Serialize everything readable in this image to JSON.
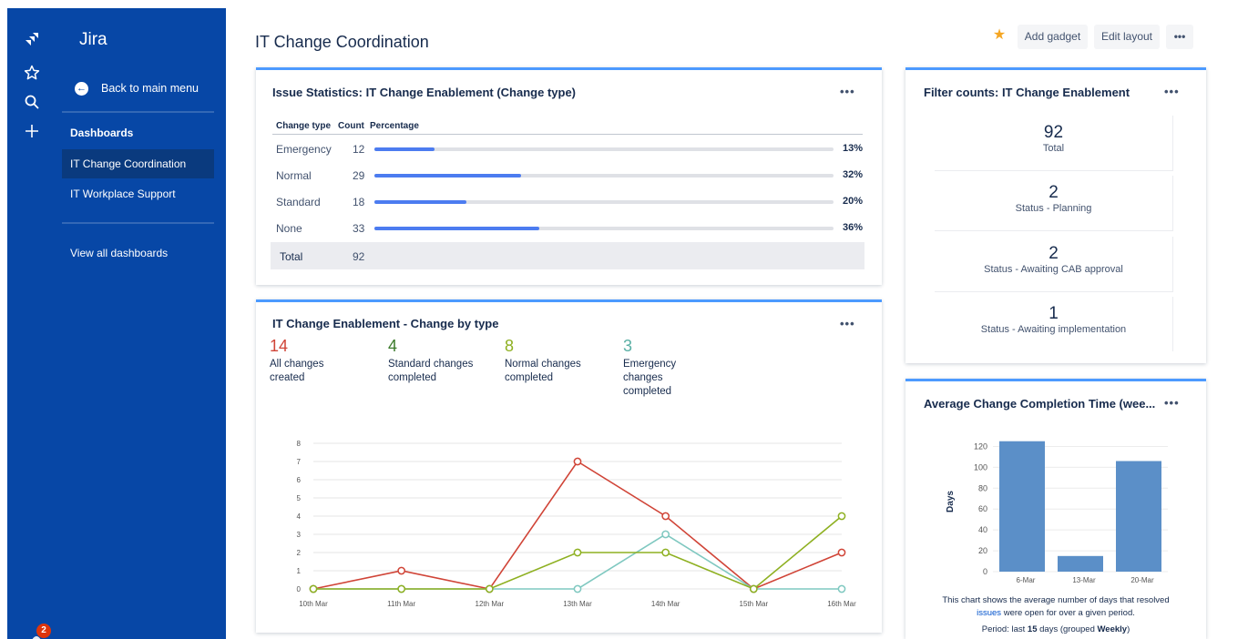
{
  "app": {
    "brand": "Jira",
    "notifications": "2"
  },
  "sidebar": {
    "back_label": "Back to main menu",
    "section": "Dashboards",
    "items": [
      {
        "label": "IT Change Coordination",
        "active": true
      },
      {
        "label": "IT Workplace Support",
        "active": false
      }
    ],
    "view_all": "View all dashboards"
  },
  "header": {
    "title": "IT Change Coordination",
    "add_gadget": "Add gadget",
    "edit_layout": "Edit layout",
    "more": "•••"
  },
  "issue_stats": {
    "title": "Issue Statistics: IT Change Enablement (Change type)",
    "headers": [
      "Change type",
      "Count",
      "Percentage"
    ],
    "rows": [
      {
        "type": "Emergency",
        "count": "12",
        "percent": "13%",
        "fraction": 0.13
      },
      {
        "type": "Normal",
        "count": "29",
        "percent": "32%",
        "fraction": 0.32
      },
      {
        "type": "Standard",
        "count": "18",
        "percent": "20%",
        "fraction": 0.2
      },
      {
        "type": "None",
        "count": "33",
        "percent": "36%",
        "fraction": 0.36
      }
    ],
    "total_label": "Total",
    "total_value": "92"
  },
  "change_by_type": {
    "title": "IT Change Enablement - Change by type",
    "metrics": [
      {
        "value": "14",
        "label": "All changes created",
        "color": "#d04437"
      },
      {
        "value": "4",
        "label": "Standard changes completed",
        "color": "#3b7a2a"
      },
      {
        "value": "8",
        "label": "Normal changes completed",
        "color": "#8eb021"
      },
      {
        "value": "3",
        "label": "Emergency changes completed",
        "color": "#59afa4"
      }
    ]
  },
  "filter_counts": {
    "title": "Filter counts: IT Change Enablement",
    "items": [
      {
        "value": "92",
        "label": "Total"
      },
      {
        "value": "2",
        "label": "Status - Planning"
      },
      {
        "value": "2",
        "label": "Status - Awaiting CAB approval"
      },
      {
        "value": "1",
        "label": "Status - Awaiting implementation"
      }
    ]
  },
  "avg_completion": {
    "title": "Average Change Completion Time (wee...",
    "note_pre": "This chart shows the average number of days that resolved",
    "note_link": "issues",
    "note_post": "were open for over a given period.",
    "period_pre": "Period: last",
    "period_days": "15",
    "period_mid": "days (grouped",
    "period_group": "Weekly",
    "period_end": ")"
  },
  "chart_data": [
    {
      "type": "line",
      "x": [
        "10th Mar",
        "11th Mar",
        "12th Mar",
        "13th Mar",
        "14th Mar",
        "15th Mar",
        "16th Mar"
      ],
      "ylim": [
        0,
        8
      ],
      "yticks": [
        "0",
        "1",
        "2",
        "3",
        "4",
        "5",
        "6",
        "7",
        "8"
      ],
      "grid": true,
      "series": [
        {
          "values": [
            0,
            1,
            0,
            7,
            4,
            0,
            2
          ],
          "color": "#d04437"
        },
        {
          "values": [
            0,
            0,
            0,
            0,
            3,
            0,
            0
          ],
          "color": "#7fc8c0"
        },
        {
          "values": [
            0,
            0,
            0,
            2,
            2,
            0,
            4
          ],
          "color": "#8eb021"
        }
      ]
    },
    {
      "type": "bar",
      "categories": [
        "6-Mar",
        "13-Mar",
        "20-Mar"
      ],
      "values": [
        125,
        15,
        106
      ],
      "ylabel": "Days",
      "ylim": [
        0,
        130
      ],
      "yticks": [
        "0",
        "20",
        "40",
        "60",
        "80",
        "100",
        "120"
      ],
      "color": "#5b8fc8",
      "grid": true
    }
  ]
}
